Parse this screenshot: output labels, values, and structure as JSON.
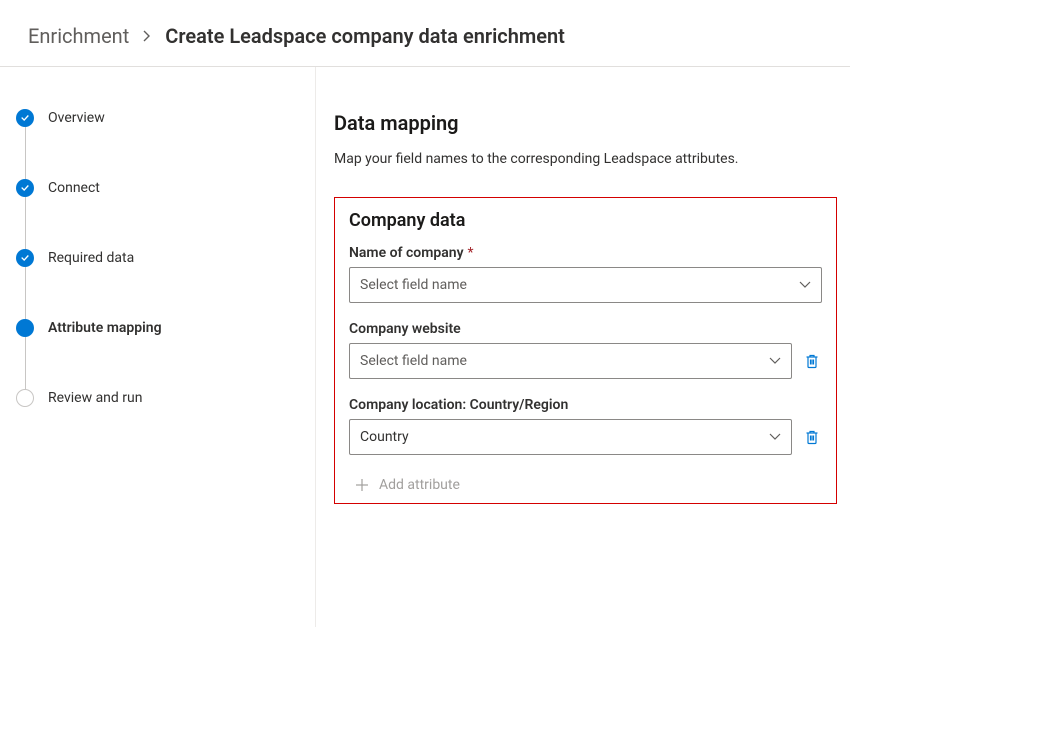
{
  "breadcrumb": {
    "parent": "Enrichment",
    "current": "Create Leadspace company data enrichment"
  },
  "stepper": {
    "items": [
      {
        "label": "Overview",
        "state": "completed"
      },
      {
        "label": "Connect",
        "state": "completed"
      },
      {
        "label": "Required data",
        "state": "completed"
      },
      {
        "label": "Attribute mapping",
        "state": "current"
      },
      {
        "label": "Review and run",
        "state": "upcoming"
      }
    ]
  },
  "main": {
    "title": "Data mapping",
    "subtitle": "Map your field names to the corresponding Leadspace attributes."
  },
  "panel": {
    "heading": "Company data",
    "fields": {
      "name": {
        "label": "Name of company",
        "required": true,
        "placeholder": "Select field name",
        "value": ""
      },
      "website": {
        "label": "Company website",
        "required": false,
        "placeholder": "Select field name",
        "value": ""
      },
      "location": {
        "label": "Company location: Country/Region",
        "required": false,
        "placeholder": "Select field name",
        "value": "Country"
      }
    },
    "add_label": "Add attribute"
  },
  "icons": {
    "chevron_right": "chevron-right-icon",
    "chevron_down": "chevron-down-icon",
    "check": "check-icon",
    "trash": "trash-icon",
    "plus": "plus-icon"
  }
}
